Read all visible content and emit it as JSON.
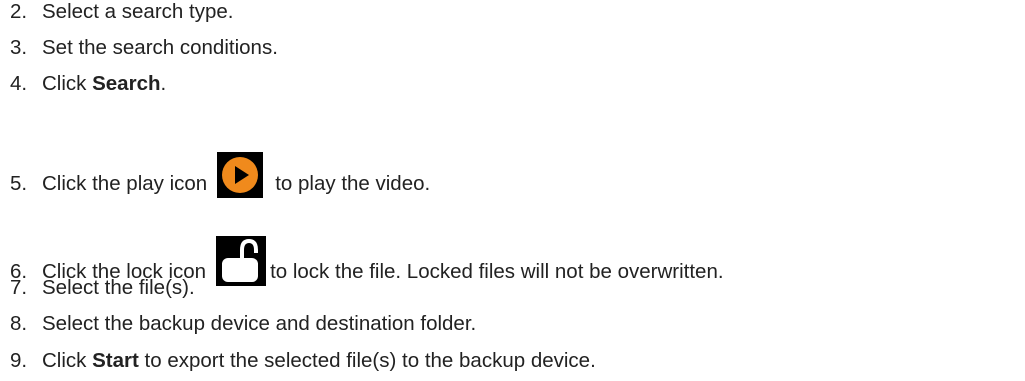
{
  "steps": [
    {
      "num": "2.",
      "before": "Select a search type.",
      "bold": "",
      "after": ""
    },
    {
      "num": "3.",
      "before": "Set the search conditions.",
      "bold": "",
      "after": ""
    },
    {
      "num": "4.",
      "before": "Click ",
      "bold": "Search",
      "after": "."
    },
    {
      "num": "5.",
      "before": "Click the play icon",
      "bold": "",
      "after": "to play the video."
    },
    {
      "num": "6.",
      "before": "Click the lock icon",
      "bold": "",
      "after": "to lock the file. Locked files will not be overwritten."
    },
    {
      "num": "7.",
      "before": "Select the file(s).",
      "bold": "",
      "after": ""
    },
    {
      "num": "8.",
      "before": "Select the backup device and destination folder.",
      "bold": "",
      "after": ""
    },
    {
      "num": "9.",
      "before": "Click ",
      "bold": "Start",
      "after": " to export the selected file(s) to the backup device."
    }
  ],
  "icons": {
    "play": {
      "name": "play-icon",
      "color": "#f08a1c"
    },
    "lock": {
      "name": "unlock-icon",
      "color": "#ffffff"
    }
  }
}
